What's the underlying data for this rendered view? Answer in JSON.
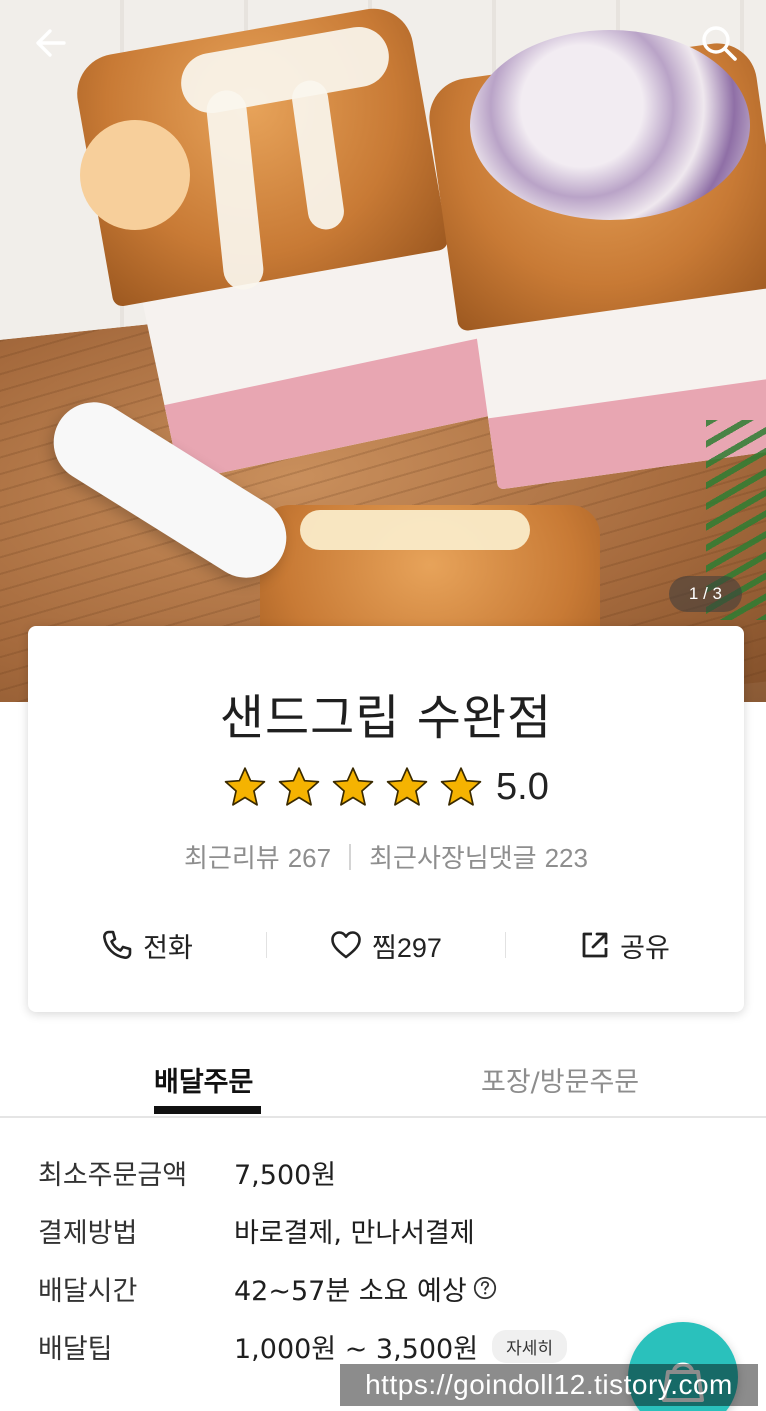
{
  "hero": {
    "page_indicator": "1 / 3"
  },
  "store": {
    "name": "샌드그립 수완점",
    "rating": "5.0",
    "rating_stars": 5,
    "recent_reviews_label": "최근리뷰",
    "recent_reviews_count": "267",
    "owner_replies_label": "최근사장님댓글",
    "owner_replies_count": "223"
  },
  "actions": {
    "call_label": "전화",
    "like_label": "찜",
    "like_count": "297",
    "share_label": "공유"
  },
  "tabs": {
    "delivery": "배달주문",
    "pickup": "포장/방문주문"
  },
  "info": {
    "min_order_label": "최소주문금액",
    "min_order_value": "7,500원",
    "payment_label": "결제방법",
    "payment_value": "바로결제, 만나서결제",
    "delivery_time_label": "배달시간",
    "delivery_time_value": "42~57분 소요 예상",
    "delivery_tip_label": "배달팁",
    "delivery_tip_value": "1,000원 ~ 3,500원",
    "detail_button": "자세히"
  },
  "watermark": "https://goindoll12.tistory.com",
  "colors": {
    "accent": "#2ac1bc",
    "star": "#f5b301"
  }
}
